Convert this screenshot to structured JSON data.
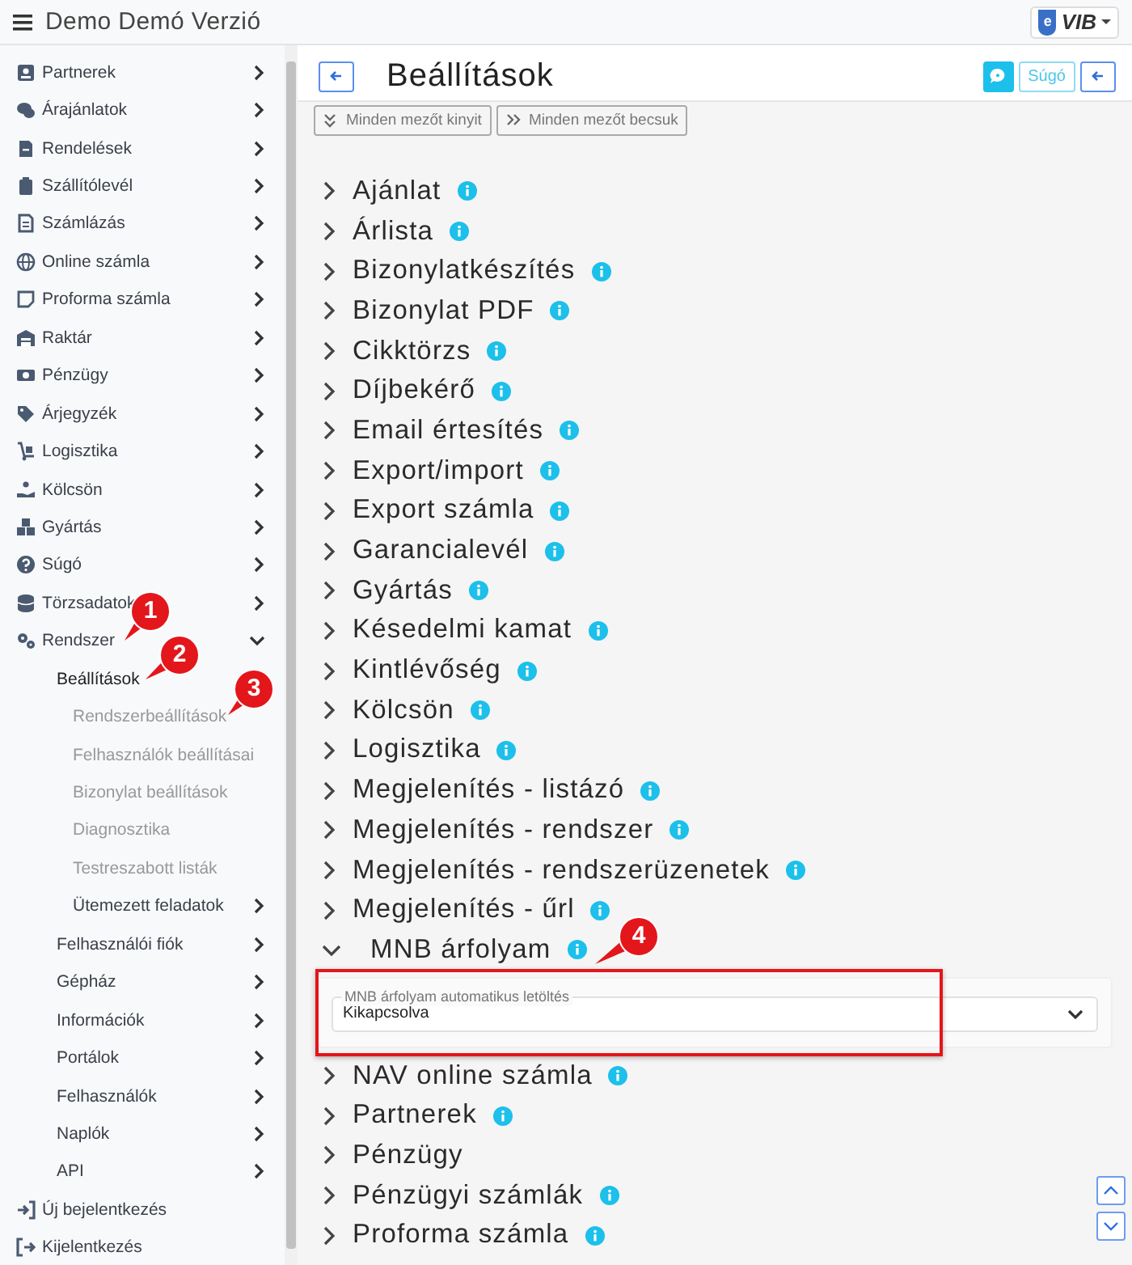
{
  "app_bar": {
    "title": "Demo Demó Verzió",
    "logo": {
      "badge": "e",
      "text": "VIB"
    }
  },
  "sidebar": {
    "items": [
      {
        "label": "Partnerek",
        "expandable": true,
        "expanded": false
      },
      {
        "label": "Árajánlatok",
        "expandable": true,
        "expanded": false
      },
      {
        "label": "Rendelések",
        "expandable": true,
        "expanded": false
      },
      {
        "label": "Szállítólevél",
        "expandable": true,
        "expanded": false
      },
      {
        "label": "Számlázás",
        "expandable": true,
        "expanded": false
      },
      {
        "label": "Online számla",
        "expandable": true,
        "expanded": false
      },
      {
        "label": "Proforma számla",
        "expandable": true,
        "expanded": false
      },
      {
        "label": "Raktár",
        "expandable": true,
        "expanded": false
      },
      {
        "label": "Pénzügy",
        "expandable": true,
        "expanded": false
      },
      {
        "label": "Árjegyzék",
        "expandable": true,
        "expanded": false
      },
      {
        "label": "Logisztika",
        "expandable": true,
        "expanded": false
      },
      {
        "label": "Kölcsön",
        "expandable": true,
        "expanded": false
      },
      {
        "label": "Gyártás",
        "expandable": true,
        "expanded": false
      },
      {
        "label": "Súgó",
        "expandable": true,
        "expanded": false
      },
      {
        "label": "Törzsadatok",
        "expandable": true,
        "expanded": false
      },
      {
        "label": "Rendszer",
        "expandable": true,
        "expanded": true,
        "children": [
          {
            "label": "Beállítások",
            "expandable": false,
            "expanded": true,
            "children": [
              {
                "label": "Rendszerbeállítások",
                "expandable": false,
                "expanded": false
              },
              {
                "label": "Felhasználók beállításai",
                "expandable": false,
                "expanded": false
              },
              {
                "label": "Bizonylat beállítások",
                "expandable": false,
                "expanded": false
              },
              {
                "label": "Diagnosztika",
                "expandable": false,
                "expanded": false
              },
              {
                "label": "Testreszabott listák",
                "expandable": false,
                "expanded": false
              },
              {
                "label": "Ütemezett feladatok",
                "expandable": true,
                "expanded": false
              }
            ]
          },
          {
            "label": "Felhasználói fiók",
            "expandable": true,
            "expanded": false
          },
          {
            "label": "Gépház",
            "expandable": true,
            "expanded": false
          },
          {
            "label": "Információk",
            "expandable": true,
            "expanded": false
          },
          {
            "label": "Portálok",
            "expandable": true,
            "expanded": false
          },
          {
            "label": "Felhasználók",
            "expandable": true,
            "expanded": false
          },
          {
            "label": "Naplók",
            "expandable": true,
            "expanded": false
          },
          {
            "label": "API",
            "expandable": true,
            "expanded": false
          }
        ]
      },
      {
        "label": "Új bejelentkezés",
        "expandable": false,
        "expanded": false
      },
      {
        "label": "Kijelentkezés",
        "expandable": false,
        "expanded": false
      }
    ]
  },
  "page": {
    "title": "Beállítások",
    "help_button": "Súgó",
    "toolbar": [
      "Minden mezőt kinyit",
      "Minden mezőt becsuk"
    ],
    "sections": [
      {
        "label": "Ajánlat",
        "info": true,
        "expanded": false
      },
      {
        "label": "Árlista",
        "info": true,
        "expanded": false
      },
      {
        "label": "Bizonylatkészítés",
        "info": true,
        "expanded": false
      },
      {
        "label": "Bizonylat PDF",
        "info": true,
        "expanded": false
      },
      {
        "label": "Cikktörzs",
        "info": true,
        "expanded": false
      },
      {
        "label": "Díjbekérő",
        "info": true,
        "expanded": false
      },
      {
        "label": "Email értesítés",
        "info": true,
        "expanded": false
      },
      {
        "label": "Export/import",
        "info": true,
        "expanded": false
      },
      {
        "label": "Export számla",
        "info": true,
        "expanded": false
      },
      {
        "label": "Garancialevél",
        "info": true,
        "expanded": false
      },
      {
        "label": "Gyártás",
        "info": true,
        "expanded": false
      },
      {
        "label": "Késedelmi kamat",
        "info": true,
        "expanded": false
      },
      {
        "label": "Kintlévőség",
        "info": true,
        "expanded": false
      },
      {
        "label": "Kölcsön",
        "info": true,
        "expanded": false
      },
      {
        "label": "Logisztika",
        "info": true,
        "expanded": false
      },
      {
        "label": "Megjelenítés - listázó",
        "info": true,
        "expanded": false
      },
      {
        "label": "Megjelenítés - rendszer",
        "info": true,
        "expanded": false
      },
      {
        "label": "Megjelenítés - rendszerüzenetek",
        "info": true,
        "expanded": false
      },
      {
        "label": "Megjelenítés - űrl",
        "info": true,
        "expanded": false
      },
      {
        "label": "MNB árfolyam",
        "info": true,
        "expanded": true,
        "fields": [
          {
            "label": "MNB árfolyam automatikus letöltés",
            "value": "Kikapcsolva"
          }
        ]
      },
      {
        "label": "NAV online számla",
        "info": true,
        "expanded": false
      },
      {
        "label": "Partnerek",
        "info": true,
        "expanded": false
      },
      {
        "label": "Pénzügy",
        "info": false,
        "expanded": false
      },
      {
        "label": "Pénzügyi számlák",
        "info": true,
        "expanded": false
      },
      {
        "label": "Proforma számla",
        "info": true,
        "expanded": false
      }
    ]
  },
  "callouts": [
    "1",
    "2",
    "3",
    "4"
  ]
}
